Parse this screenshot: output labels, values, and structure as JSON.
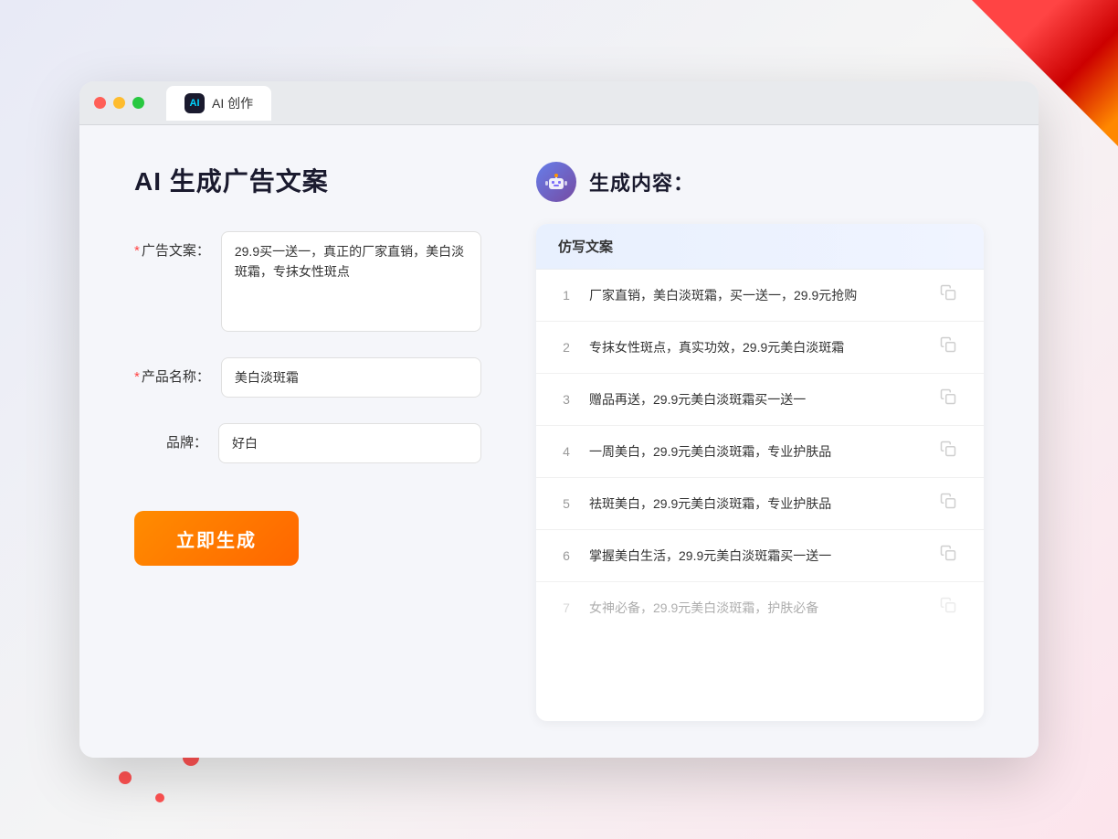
{
  "window": {
    "tab_label": "AI 创作",
    "tab_icon_text": "AI"
  },
  "left_panel": {
    "title": "AI 生成广告文案",
    "ad_copy_label": "广告文案：",
    "ad_copy_required": "*",
    "ad_copy_value": "29.9买一送一，真正的厂家直销，美白淡斑霜，专抹女性斑点",
    "product_name_label": "产品名称：",
    "product_name_required": "*",
    "product_name_value": "美白淡斑霜",
    "brand_label": "品牌：",
    "brand_value": "好白",
    "generate_button": "立即生成"
  },
  "right_panel": {
    "title": "生成内容：",
    "column_header": "仿写文案",
    "results": [
      {
        "num": "1",
        "text": "厂家直销，美白淡斑霜，买一送一，29.9元抢购",
        "dimmed": false
      },
      {
        "num": "2",
        "text": "专抹女性斑点，真实功效，29.9元美白淡斑霜",
        "dimmed": false
      },
      {
        "num": "3",
        "text": "赠品再送，29.9元美白淡斑霜买一送一",
        "dimmed": false
      },
      {
        "num": "4",
        "text": "一周美白，29.9元美白淡斑霜，专业护肤品",
        "dimmed": false
      },
      {
        "num": "5",
        "text": "祛斑美白，29.9元美白淡斑霜，专业护肤品",
        "dimmed": false
      },
      {
        "num": "6",
        "text": "掌握美白生活，29.9元美白淡斑霜买一送一",
        "dimmed": false
      },
      {
        "num": "7",
        "text": "女神必备，29.9元美白淡斑霜，护肤必备",
        "dimmed": true
      }
    ]
  }
}
